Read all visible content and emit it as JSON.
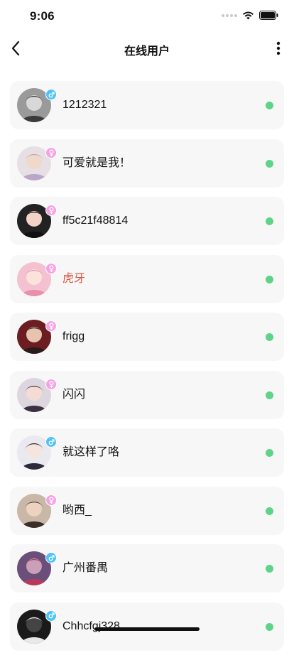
{
  "status_bar": {
    "time": "9:06"
  },
  "header": {
    "title": "在线用户"
  },
  "colors": {
    "online": "#5fd389",
    "male_badge": "#4fc3f7",
    "female_badge": "#f6a3e4",
    "highlight_name": "#e0533f",
    "default_name": "#111111"
  },
  "users": [
    {
      "name": "1212321",
      "gender": "male",
      "online": true,
      "highlight": false,
      "avatar": {
        "bg": "#9a9a9a",
        "fg": "#3b3b3b",
        "skin": "#d8d8d8"
      }
    },
    {
      "name": "可爱就是我！",
      "gender": "female",
      "online": true,
      "highlight": false,
      "avatar": {
        "bg": "#e6dfe4",
        "fg": "#b9a7c7",
        "skin": "#f1d9c9"
      }
    },
    {
      "name": "ff5c21f48814",
      "gender": "female",
      "online": true,
      "highlight": false,
      "avatar": {
        "bg": "#222222",
        "fg": "#111111",
        "skin": "#f2d3c8"
      }
    },
    {
      "name": "虎牙",
      "gender": "female",
      "online": true,
      "highlight": true,
      "avatar": {
        "bg": "#f3c1cf",
        "fg": "#e98fac",
        "skin": "#fbe3dc"
      }
    },
    {
      "name": "frigg",
      "gender": "female",
      "online": true,
      "highlight": false,
      "avatar": {
        "bg": "#6b1d22",
        "fg": "#2b1a1a",
        "skin": "#e8c3b0"
      }
    },
    {
      "name": "闪闪",
      "gender": "female",
      "online": true,
      "highlight": false,
      "avatar": {
        "bg": "#ddd6de",
        "fg": "#3a3040",
        "skin": "#f4dcd4"
      }
    },
    {
      "name": "就这样了咯",
      "gender": "male",
      "online": true,
      "highlight": false,
      "avatar": {
        "bg": "#e9e9ef",
        "fg": "#2a2a3a",
        "skin": "#f5e5df"
      }
    },
    {
      "name": "哟西_",
      "gender": "female",
      "online": true,
      "highlight": false,
      "avatar": {
        "bg": "#c9b8a8",
        "fg": "#3b2f2a",
        "skin": "#edd2c0"
      }
    },
    {
      "name": "广州番禺",
      "gender": "male",
      "online": true,
      "highlight": false,
      "avatar": {
        "bg": "#6a4f7a",
        "fg": "#b83a5a",
        "skin": "#c9a0b8"
      }
    },
    {
      "name": "Chhcfgj328",
      "gender": "male",
      "online": true,
      "highlight": false,
      "avatar": {
        "bg": "#1a1a1a",
        "fg": "#e8e8e8",
        "skin": "#444444"
      }
    }
  ]
}
